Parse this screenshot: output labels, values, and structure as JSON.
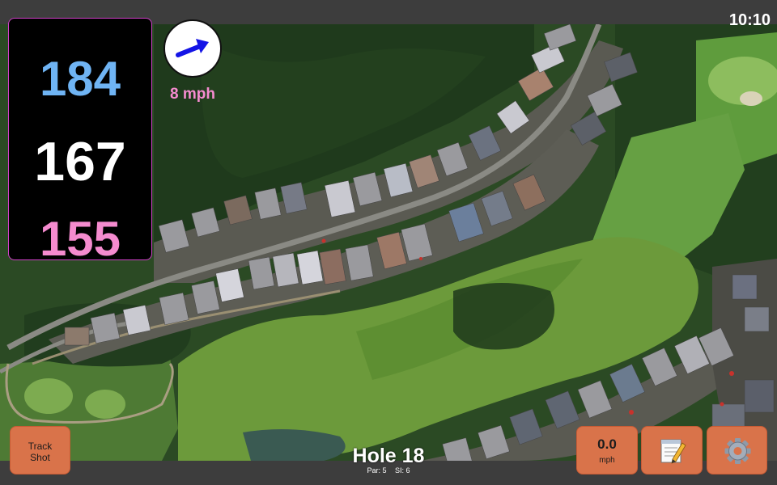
{
  "status_bar": {
    "clock": "10:10"
  },
  "distances": {
    "back": "184",
    "middle": "167",
    "front": "155"
  },
  "wind": {
    "speed_label": "8 mph",
    "direction_icon": "arrow-icon",
    "arrow_color": "#1414e6"
  },
  "hole": {
    "title": "Hole 18",
    "par_label": "Par: 5",
    "si_label": "SI: 6"
  },
  "buttons": {
    "track_shot": {
      "line1": "Track",
      "line2": "Shot"
    },
    "speed": {
      "value": "0.0",
      "unit": "mph"
    },
    "notes_icon": "notepad-icon",
    "settings_icon": "gear-icon"
  },
  "colors": {
    "back_distance": "#6fb4f4",
    "middle_distance": "#ffffff",
    "front_distance": "#f58bcf",
    "button_bg": "#d9734a",
    "panel_border": "#d040c8"
  }
}
